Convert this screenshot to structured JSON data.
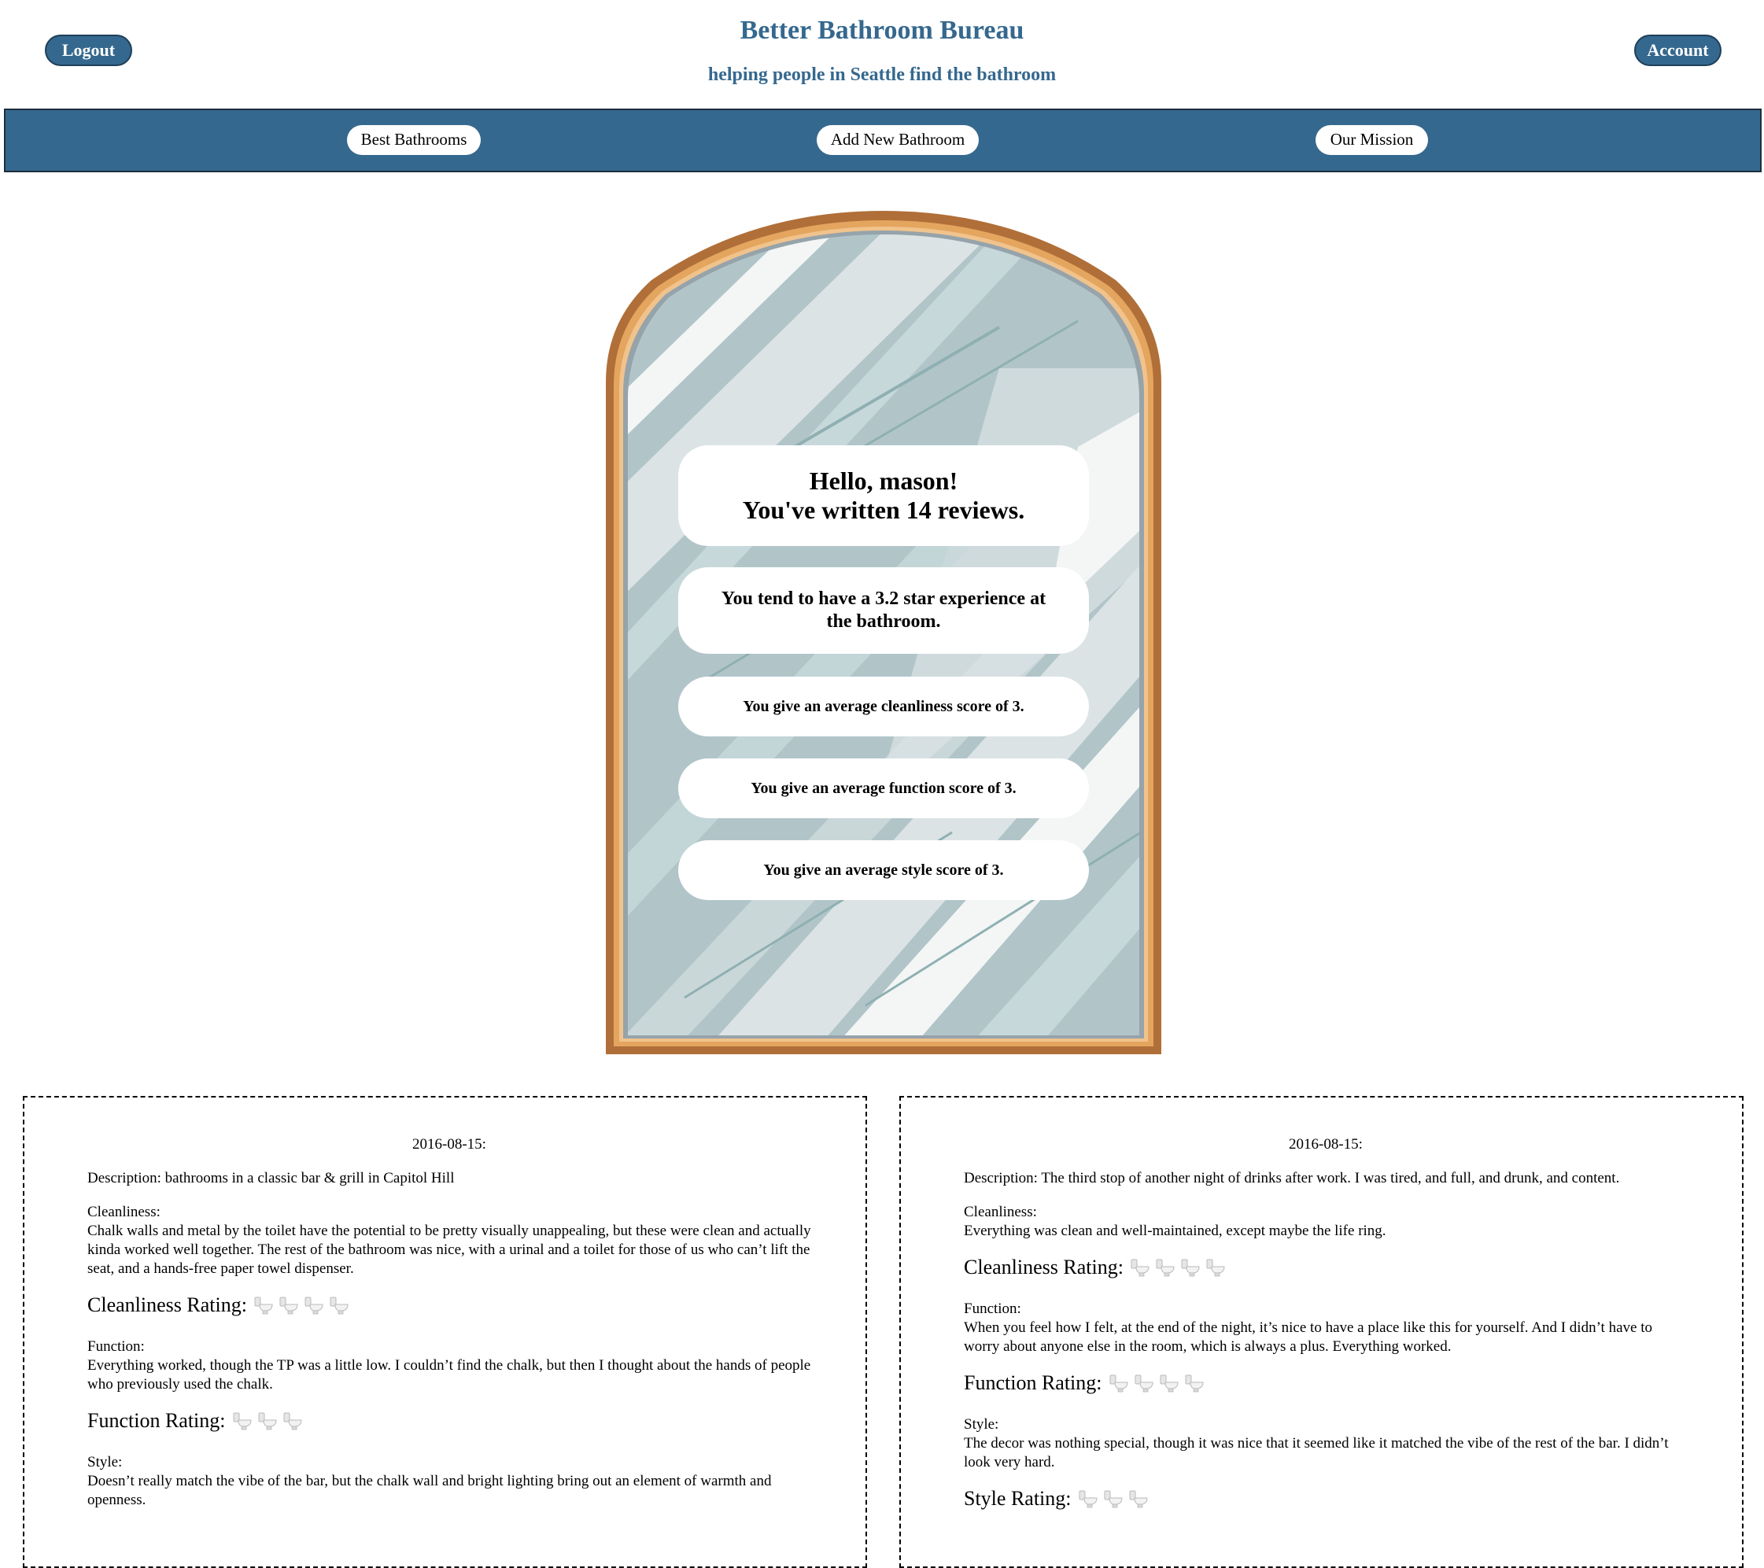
{
  "header": {
    "title": "Better Bathroom Bureau",
    "subtitle": "helping people in Seattle find the bathroom",
    "logout_label": "Logout",
    "account_label": "Account"
  },
  "nav": {
    "items": [
      {
        "label": "Best Bathrooms"
      },
      {
        "label": "Add New Bathroom"
      },
      {
        "label": "Our Mission"
      }
    ]
  },
  "colors": {
    "brand": "#35688e",
    "mirror_frame": "#b06f38",
    "mirror_glass": "#b8cdd1"
  },
  "stats": {
    "greeting_line1": "Hello, mason!",
    "greeting_line2": "You've written 14 reviews.",
    "star_experience": "You tend to have a 3.2 star experience at the bathroom.",
    "cleanliness": "You give an average cleanliness score of 3.",
    "function": "You give an average function score of 3.",
    "style": "You give an average style score of 3."
  },
  "reviews": [
    {
      "date": "2016-08-15:",
      "description": "Description: bathrooms in a classic bar & grill in Capitol Hill",
      "cleanliness_heading": "Cleanliness:",
      "cleanliness_text": "Chalk walls and metal by the toilet have the potential to be pretty visually unappealing, but these were clean and actually kinda worked well together. The rest of the bathroom was nice, with a urinal and a toilet for those of us who can’t lift the seat, and a hands-free paper towel dispenser.",
      "cleanliness_rating_label": "Cleanliness Rating:",
      "cleanliness_rating": 4,
      "function_heading": "Function:",
      "function_text": "Everything worked, though the TP was a little low. I couldn’t find the chalk, but then I thought about the hands of people who previously used the chalk.",
      "function_rating_label": "Function Rating:",
      "function_rating": 3,
      "style_heading": "Style:",
      "style_text": "Doesn’t really match the vibe of the bar, but the chalk wall and bright lighting bring out an element of warmth and openness."
    },
    {
      "date": "2016-08-15:",
      "description": "Description: The third stop of another night of drinks after work. I was tired, and full, and drunk, and content.",
      "cleanliness_heading": "Cleanliness:",
      "cleanliness_text": "Everything was clean and well-maintained, except maybe the life ring.",
      "cleanliness_rating_label": "Cleanliness Rating:",
      "cleanliness_rating": 4,
      "function_heading": "Function:",
      "function_text": "When you feel how I felt, at the end of the night, it’s nice to have a place like this for yourself. And I didn’t have to worry about anyone else in the room, which is always a plus. Everything worked.",
      "function_rating_label": "Function Rating:",
      "function_rating": 4,
      "style_heading": "Style:",
      "style_text": "The decor was nothing special, though it was nice that it seemed like it matched the vibe of the rest of the bar. I didn’t look very hard.",
      "style_rating_label": "Style Rating:",
      "style_rating": 3
    }
  ]
}
